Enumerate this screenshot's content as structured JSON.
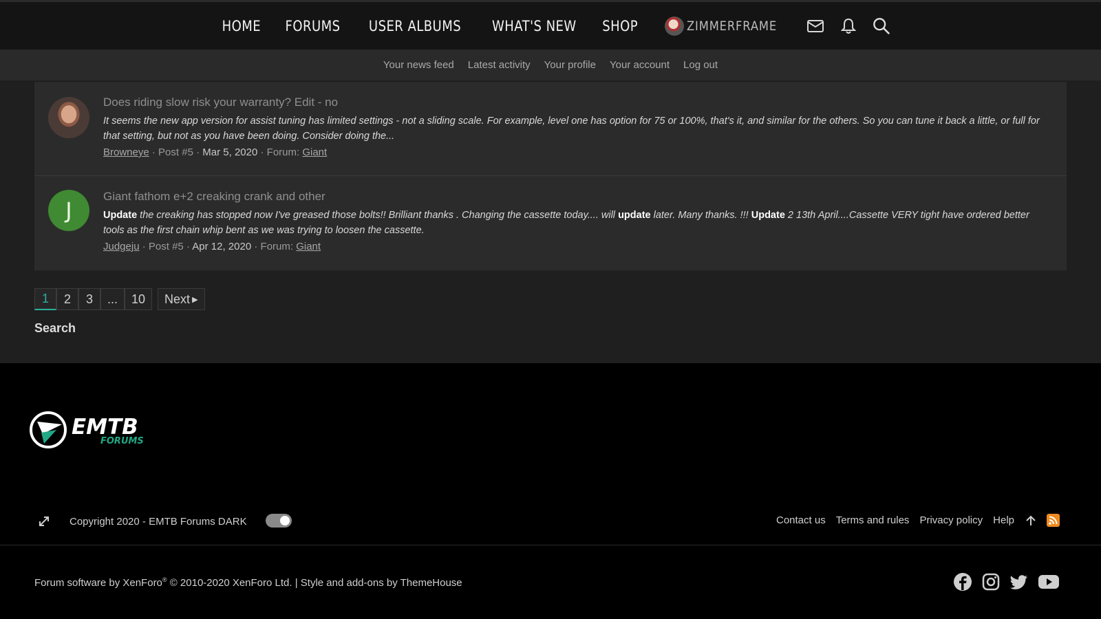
{
  "nav": {
    "items": [
      "HOME",
      "FORUMS",
      "USER ALBUMS",
      "WHAT'S NEW",
      "SHOP"
    ],
    "user_name": "ZIMMERFRAME"
  },
  "subnav": [
    "Your news feed",
    "Latest activity",
    "Your profile",
    "Your account",
    "Log out"
  ],
  "results": [
    {
      "title": "Does riding slow risk your warranty? Edit - no",
      "snippet": "It seems the new app version for assist tuning has limited settings - not a sliding scale. For example, level one has option for 75 or 100%, that's it, and similar for the others. So you can tune it back a little, or full for that setting, but not as you have been doing. Consider doing the...",
      "author": "Browneye",
      "post": "Post #5",
      "date": "Mar 5, 2020",
      "forum_label": "Forum:",
      "forum": "Giant"
    },
    {
      "title": "Giant fathom e+2 creaking crank and other",
      "avatar_letter": "J",
      "snippet_parts": [
        "Update",
        " the creaking has stopped now I've greased those bolts!! Brilliant thanks . Changing the cassette today.... will ",
        "update",
        " later. Many thanks. !!! ",
        "Update",
        " 2 13th April....Cassette VERY tight have ordered better tools as the first chain whip bent as we was trying to loosen the cassette."
      ],
      "author": "Judgeju",
      "post": "Post #5",
      "date": "Apr 12, 2020",
      "forum_label": "Forum:",
      "forum": "Giant"
    }
  ],
  "pagination": {
    "pages": [
      "1",
      "2",
      "3",
      "...",
      "10"
    ],
    "active": "1",
    "next": "Next"
  },
  "search_heading": "Search",
  "footer": {
    "logo_text": "EMTB",
    "logo_sub": "FORUMS",
    "copyright": "Copyright 2020 - EMTB Forums DARK",
    "links": [
      "Contact us",
      "Terms and rules",
      "Privacy policy",
      "Help"
    ],
    "software_prefix": "Forum software by XenForo",
    "software_reg": "®",
    "software_suffix": " © 2010-2020 XenForo Ltd. | Style and add-ons by ThemeHouse"
  },
  "colors": {
    "accent": "#29b39a",
    "rss": "#f08a1f",
    "avatar_green": "#3f8a32"
  }
}
